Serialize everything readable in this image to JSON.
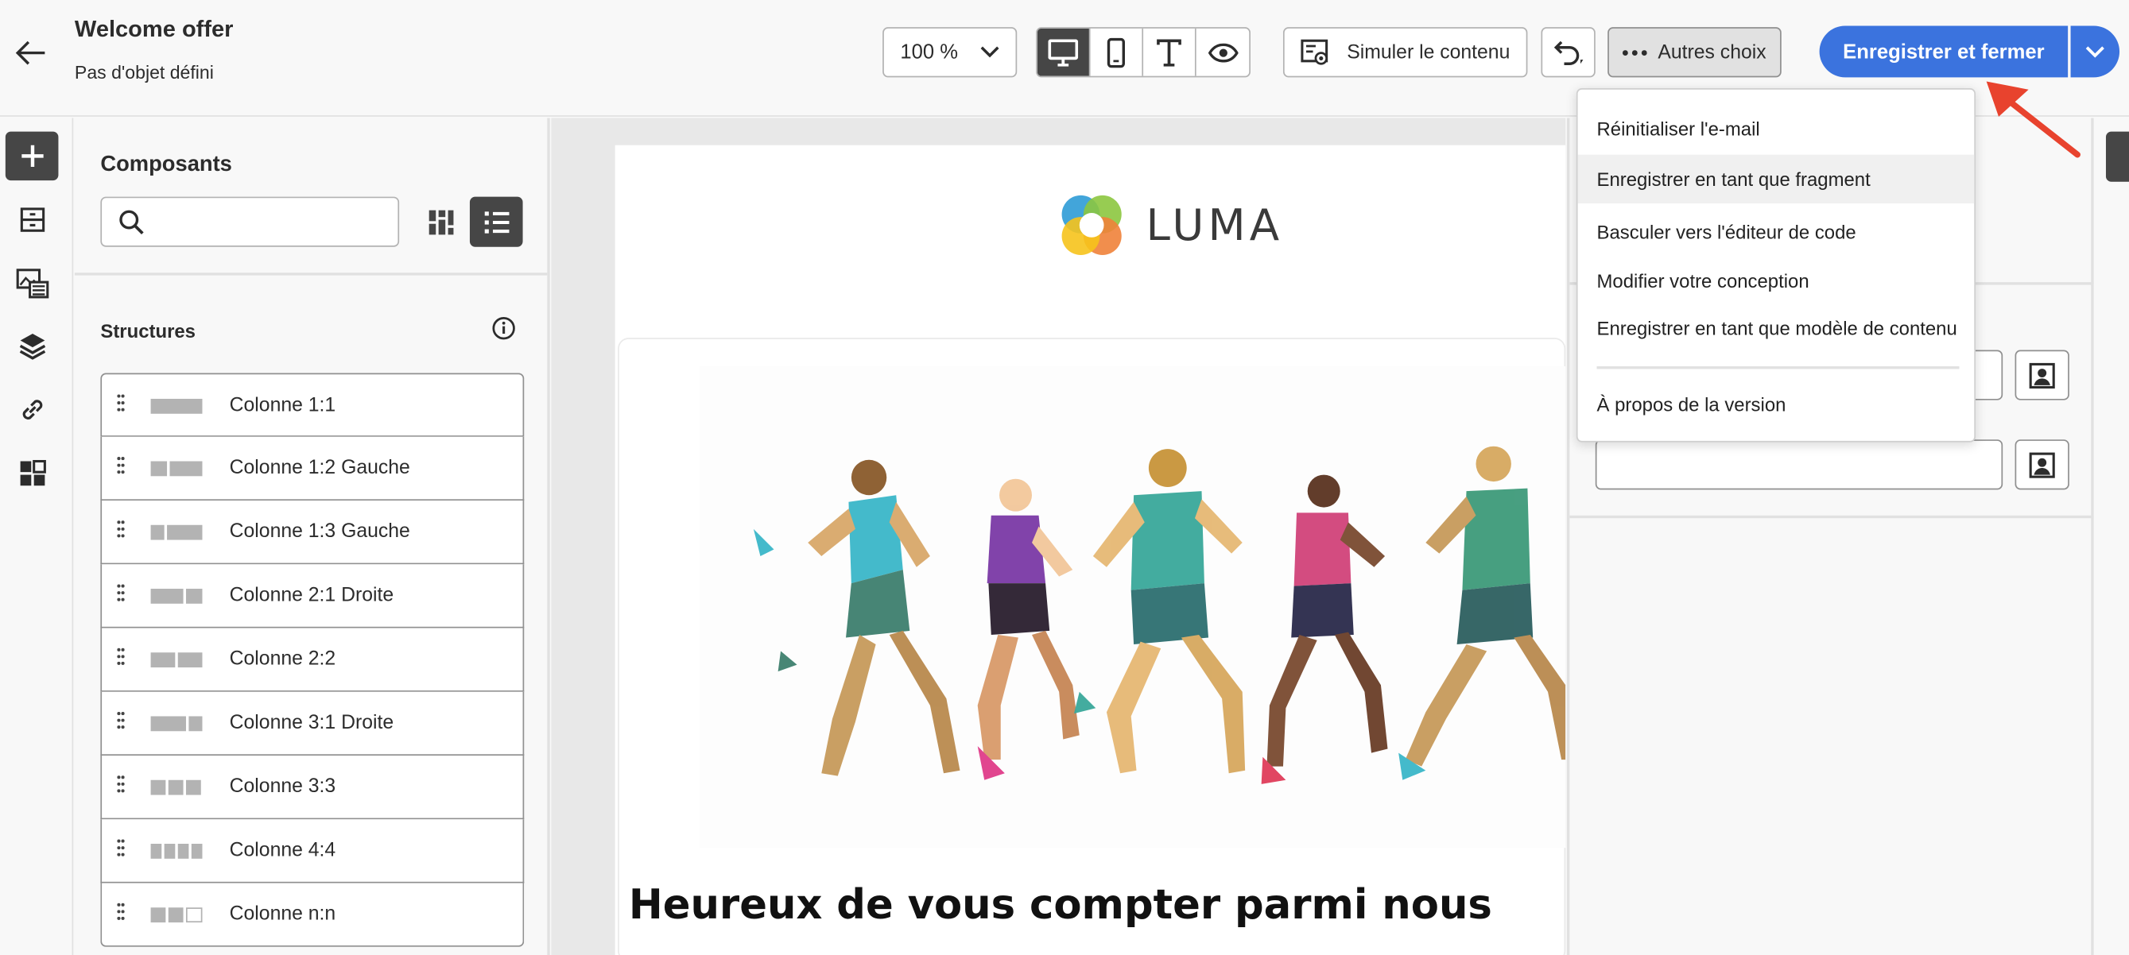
{
  "header": {
    "title": "Welcome offer",
    "subtitle": "Pas d'objet défini",
    "zoom_value": "100 %",
    "simulate_label": "Simuler le contenu",
    "more_label": "Autres choix",
    "save_label": "Enregistrer et fermer"
  },
  "view_modes": [
    "desktop-view",
    "mobile-view",
    "text-view",
    "preview"
  ],
  "components_panel": {
    "title": "Composants",
    "search_placeholder": "",
    "section_title": "Structures",
    "structures": [
      "Colonne 1:1",
      "Colonne 1:2 Gauche",
      "Colonne 1:3 Gauche",
      "Colonne 2:1 Droite",
      "Colonne 2:2",
      "Colonne 3:1 Droite",
      "Colonne 3:3",
      "Colonne 4:4",
      "Colonne n:n"
    ]
  },
  "email": {
    "logo_text": "LUMA",
    "heading": "Heureux de vous compter parmi nous"
  },
  "more_menu": {
    "items": [
      "Réinitialiser l'e-mail",
      "Enregistrer en tant que fragment",
      "Basculer vers l'éditeur de code",
      "Modifier votre conception",
      "Enregistrer en tant que modèle de contenu",
      "À propos de la version"
    ],
    "highlighted_index": 1
  },
  "colors": {
    "accent": "#3b73de",
    "dark_button": "#464646",
    "annotation_arrow": "#e8432e"
  }
}
